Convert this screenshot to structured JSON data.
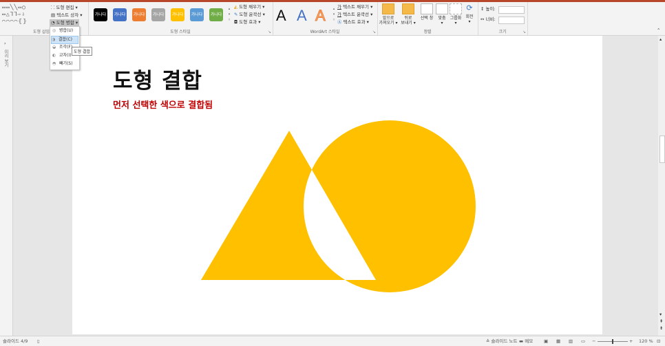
{
  "ribbon": {
    "shape_insert": {
      "title": "도형 삽입",
      "edit_shape": "도형 편집",
      "text_box": "텍스트 상자",
      "merge_shapes": "도형 병합"
    },
    "shape_styles": {
      "title": "도형 스타일",
      "swatch_label": "가나다",
      "swatches": [
        "#000000",
        "#4472c4",
        "#ed7d31",
        "#a5a5a5",
        "#ffc000",
        "#5b9bd5",
        "#70ad47"
      ],
      "fill": "도형 채우기",
      "outline": "도형 윤곽선",
      "effects": "도형 효과"
    },
    "wordart": {
      "title": "WordArt 스타일",
      "letter": "A",
      "text_fill": "텍스트 채우기",
      "text_outline": "텍스트 윤곽선",
      "text_effects": "텍스트 효과"
    },
    "arrange": {
      "title": "정렬",
      "bring_forward_1": "앞으로",
      "bring_forward_2": "가져오기",
      "send_backward_1": "뒤로",
      "send_backward_2": "보내기",
      "selection_pane": "선택 창",
      "align": "맞춤",
      "group": "그룹화",
      "rotate": "회전"
    },
    "size": {
      "title": "크기",
      "height_label": "높이:",
      "width_label": "너비:"
    }
  },
  "merge_menu": {
    "items": [
      "병합(U)",
      "결합(C)",
      "조각(F)",
      "교차(I)",
      "빼기(S)"
    ],
    "tooltip": "도형 결합"
  },
  "thumbnails": {
    "label": "미리 보기"
  },
  "slide": {
    "title": "도형 결합",
    "subtitle": "먼저 선택한 색으로 결합됨",
    "shape_color": "#ffc000"
  },
  "statusbar": {
    "slide_indicator": "슬라이드 4/9",
    "notes": "슬라이드 노트",
    "comments": "메모",
    "zoom": "120 %"
  },
  "colors": {
    "accent": "#b7472a",
    "title_red": "#c00000"
  }
}
